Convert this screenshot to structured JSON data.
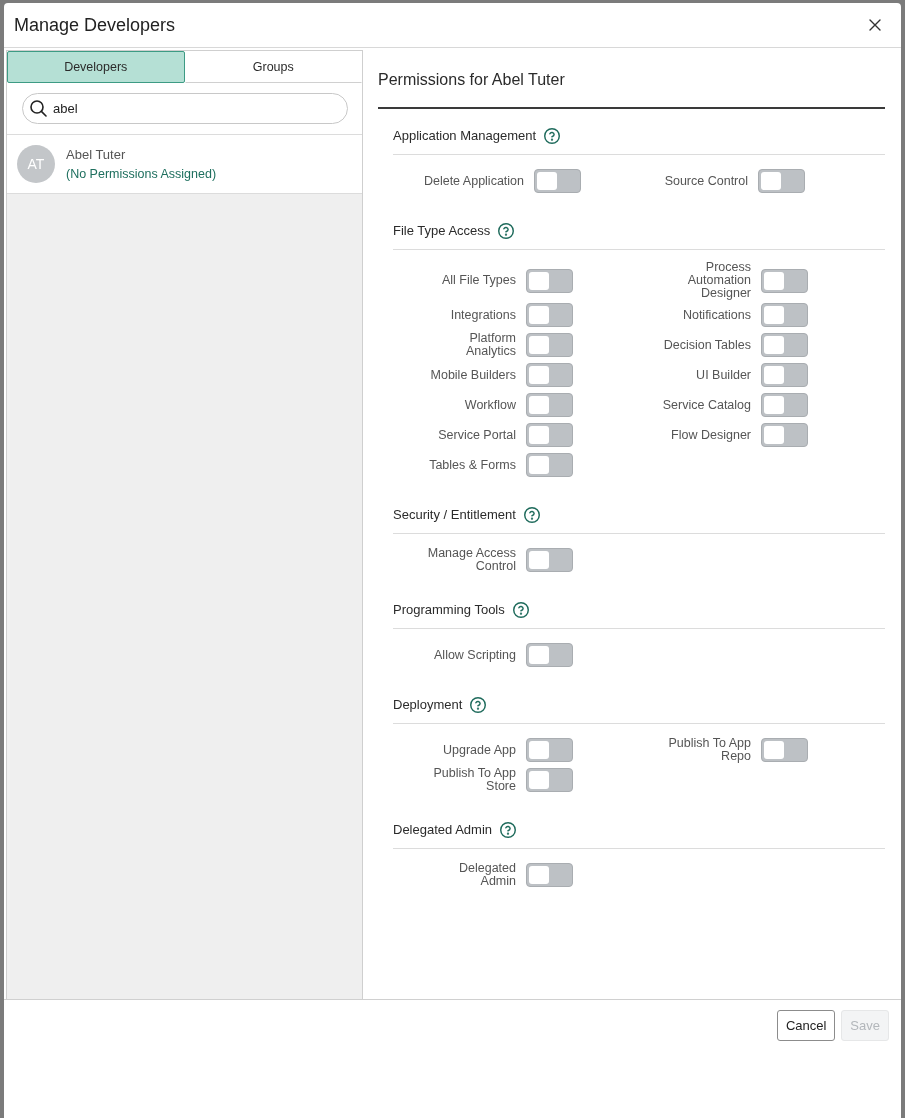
{
  "dialog": {
    "title": "Manage Developers"
  },
  "tabs": [
    {
      "label": "Developers",
      "selected": true
    },
    {
      "label": "Groups",
      "selected": false
    }
  ],
  "search": {
    "value": "abel"
  },
  "developers": [
    {
      "initials": "AT",
      "name": "Abel Tuter",
      "status": "(No Permissions Assigned)"
    }
  ],
  "permissions": {
    "title": "Permissions for Abel Tuter",
    "sections": [
      {
        "heading": "Application Management",
        "kind": "wide",
        "items": [
          {
            "label": "Delete Application",
            "on": false
          },
          {
            "label": "Source Control",
            "on": false
          }
        ]
      },
      {
        "heading": "File Type Access",
        "kind": "standard",
        "items": [
          {
            "label": "All File Types",
            "on": false
          },
          {
            "label": "Integrations",
            "on": false
          },
          {
            "label": "Platform Analytics",
            "on": false
          },
          {
            "label": "Mobile Builders",
            "on": false
          },
          {
            "label": "Workflow",
            "on": false
          },
          {
            "label": "Service Portal",
            "on": false
          },
          {
            "label": "Tables & Forms",
            "on": false
          },
          {
            "label": "Process Automation Designer",
            "on": false
          },
          {
            "label": "Notifications",
            "on": false
          },
          {
            "label": "Decision Tables",
            "on": false
          },
          {
            "label": "UI Builder",
            "on": false
          },
          {
            "label": "Service Catalog",
            "on": false
          },
          {
            "label": "Flow Designer",
            "on": false
          }
        ]
      },
      {
        "heading": "Security / Entitlement",
        "kind": "standard",
        "items": [
          {
            "label": "Manage Access Control",
            "on": false
          }
        ]
      },
      {
        "heading": "Programming Tools",
        "kind": "standard",
        "items": [
          {
            "label": "Allow Scripting",
            "on": false
          }
        ]
      },
      {
        "heading": "Deployment",
        "kind": "standard",
        "items": [
          {
            "label": "Upgrade App",
            "on": false
          },
          {
            "label": "Publish To App Store",
            "on": false
          },
          {
            "label": "Publish To App Repo",
            "on": false
          }
        ]
      },
      {
        "heading": "Delegated Admin",
        "kind": "standard",
        "items": [
          {
            "label": "Delegated Admin",
            "on": false
          }
        ]
      }
    ]
  },
  "buttons": [
    {
      "label": "Cancel",
      "disabled": false
    },
    {
      "label": "Save",
      "disabled": true
    }
  ]
}
